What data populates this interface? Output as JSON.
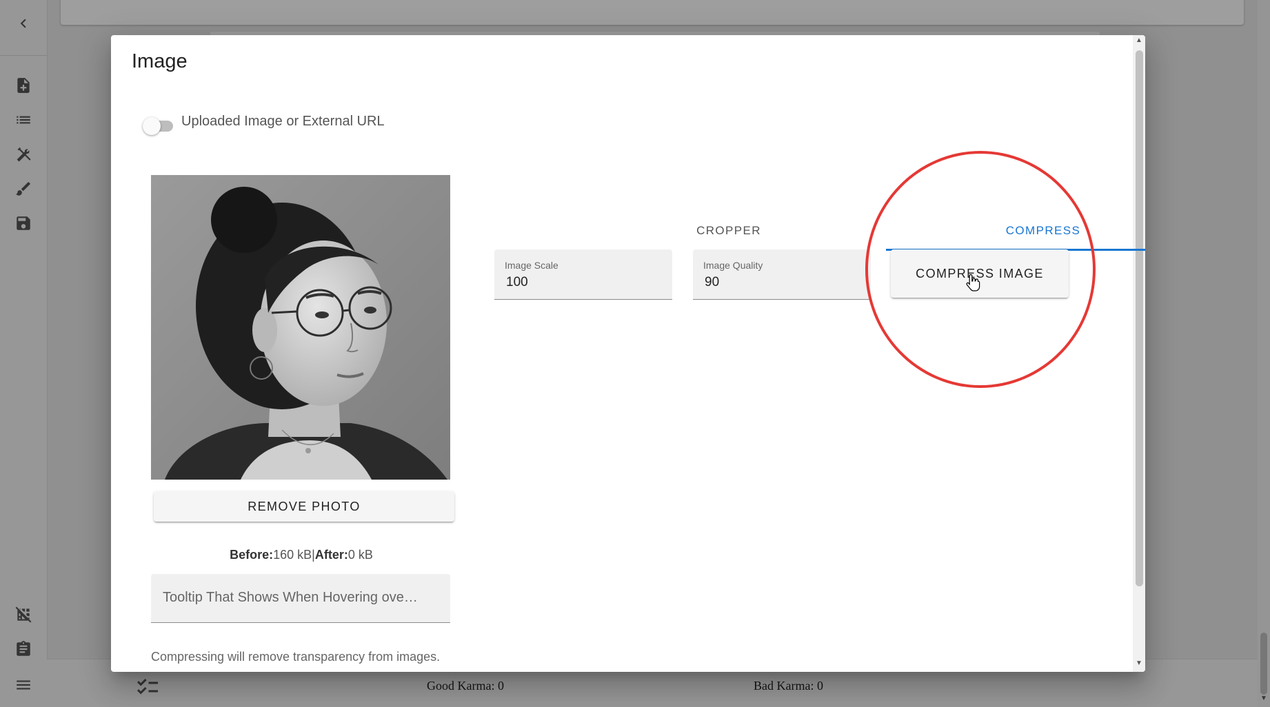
{
  "background": {
    "footer": {
      "good_karma": "Good Karma: 0",
      "bad_karma": "Bad Karma: 0"
    },
    "sidebar_icons": [
      "chevron-left-icon",
      "note-add-icon",
      "list-icon",
      "tools-icon",
      "brush-icon",
      "save-icon",
      "grid-off-icon",
      "clipboard-icon",
      "menu-icon"
    ]
  },
  "dialog": {
    "title": "Image",
    "toggle": {
      "label": "Uploaded Image or External URL",
      "checked": false
    },
    "photo": {
      "remove_label": "REMOVE PHOTO"
    },
    "sizes": {
      "before_label": "Before:",
      "before_value": "160 kB",
      "separator": "|",
      "after_label": "After:",
      "after_value": "0 kB"
    },
    "tooltip_input": {
      "placeholder": "Tooltip That Shows When Hovering ove…"
    },
    "note": "Compressing will remove transparency from images.",
    "tabs": [
      {
        "label": "CROPPER",
        "active": false
      },
      {
        "label": "COMPRESS",
        "active": true
      }
    ],
    "compress": {
      "scale_label": "Image Scale",
      "scale_value": "100",
      "quality_label": "Image Quality",
      "quality_value": "90",
      "button_label": "COMPRESS IMAGE"
    }
  },
  "colors": {
    "accent": "#1976d2",
    "highlight": "#e53935"
  }
}
